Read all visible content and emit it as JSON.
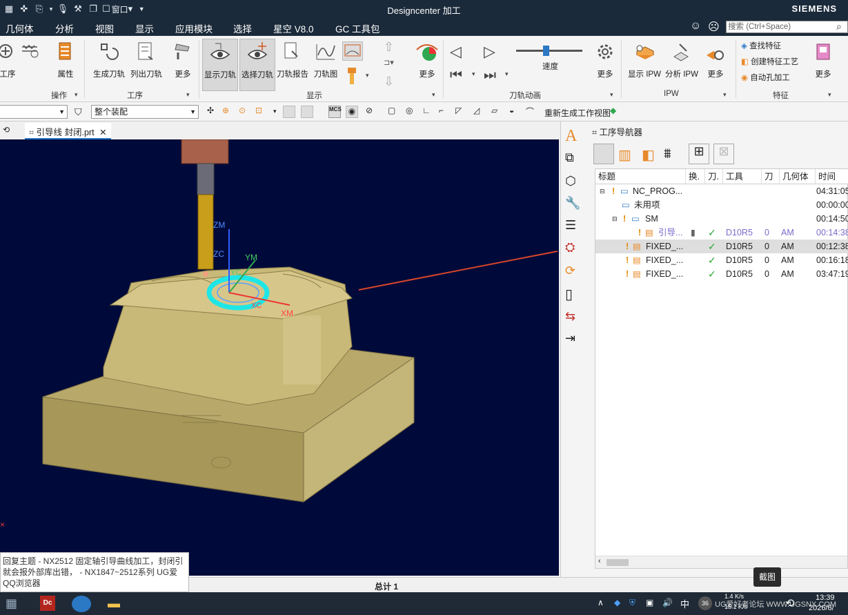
{
  "window": {
    "title": "Designcenter 加工",
    "brand": "SIEMENS",
    "quick_access_window": "窗口"
  },
  "menu": [
    "几何体",
    "分析",
    "视图",
    "显示",
    "应用模块",
    "选择",
    "星空 V8.0",
    "GC 工具包"
  ],
  "search": {
    "placeholder": "搜索 (Ctrl+Space)"
  },
  "ribbon": {
    "buttons": {
      "op": "工序",
      "props": "属性",
      "gen": "生成刀轨",
      "list": "列出刀轨",
      "more1": "更多",
      "show_path": "显示刀轨",
      "select_path": "选择刀轨",
      "report": "刀轨报告",
      "pathmap": "刀轨图",
      "more2": "更多",
      "speed": "速度",
      "more3": "更多",
      "show_ipw": "显示 IPW",
      "analyze_ipw": "分析 IPW",
      "more4": "更多",
      "find_feat": "查找特征",
      "create_feat": "创建特征工艺",
      "auto_hole": "自动孔加工",
      "more5": "更多"
    },
    "groups": {
      "operate": "操作",
      "op": "工序",
      "display": "显示",
      "anim": "刀轨动画",
      "ipw": "IPW",
      "feature": "特征"
    }
  },
  "toolbar2": {
    "filter_combo": "整个装配",
    "regen": "重新生成工作视图"
  },
  "file_tab": "引导线 封闭.prt",
  "viewport_labels": {
    "zm": "ZM",
    "zc": "ZC",
    "ym": "YM",
    "yc": "YC",
    "xc": "XC",
    "xm": "XM"
  },
  "navigator": {
    "title": "工序导航器",
    "columns": [
      "标题",
      "换.",
      "刀.",
      "工具",
      "刀",
      "几何体",
      "时间"
    ],
    "rows": [
      {
        "name": "NC_PROG...",
        "time": "04:31:05"
      },
      {
        "name": "未用项",
        "time": "00:00:00"
      },
      {
        "name": "SM",
        "time": "00:14:50"
      },
      {
        "name": "引导...",
        "tool": "D10R5",
        "num": "0",
        "geom": "AM",
        "time": "00:14:38"
      },
      {
        "name": "FIXED_...",
        "tool": "D10R5",
        "num": "0",
        "geom": "AM",
        "time": "00:12:38"
      },
      {
        "name": "FIXED_...",
        "tool": "D10R5",
        "num": "0",
        "geom": "AM",
        "time": "00:16:18"
      },
      {
        "name": "FIXED_...",
        "tool": "D10R5",
        "num": "0",
        "geom": "AM",
        "time": "03:47:19"
      }
    ]
  },
  "status": {
    "total": "总计 1"
  },
  "tooltip": {
    "lines": [
      "回复主题 - NX2512 固定轴引导曲线加工，封闭引",
      "就会报外部库出错， - NX1847~2512系列 UG爱",
      "QQ浏览器"
    ]
  },
  "screenshot_hint": "截图",
  "taskbar": {
    "ime": "中",
    "clock": "13:39",
    "date": "2026/6/",
    "net_up": "1.4 K/s",
    "net_down": "15.1 K/s",
    "watermark": "UG爱好者论坛 WWW.UGSNX.COM"
  }
}
